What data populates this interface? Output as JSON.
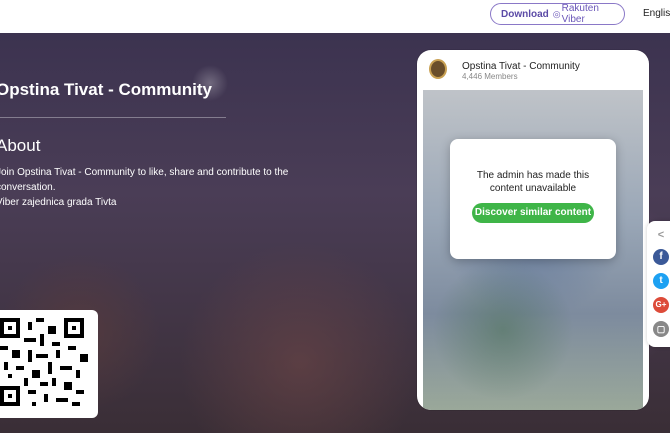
{
  "header": {
    "download_label": "Download",
    "brand_label": "Rakuten Viber",
    "language": "English"
  },
  "hero": {
    "title": "Opstina Tivat - Community",
    "about_heading": "About",
    "about_line1": "Join Opstina Tivat - Community to like, share and contribute to the",
    "about_line2": "conversation.",
    "about_line3": "Viber zajednica grada Tivta"
  },
  "phone": {
    "community_name": "Opstina Tivat - Community",
    "members": "4,446 Members",
    "modal_text_1": "The admin has made this",
    "modal_text_2": "content unavailable",
    "modal_button": "Discover similar content"
  },
  "share": {
    "icons": [
      "share-icon",
      "facebook-icon",
      "twitter-icon",
      "google-plus-icon",
      "copy-link-icon"
    ]
  },
  "colors": {
    "accent": "#665cac",
    "button_green": "#3fb548",
    "facebook": "#3b5998",
    "twitter": "#1da1f2",
    "google": "#dd4b39"
  }
}
